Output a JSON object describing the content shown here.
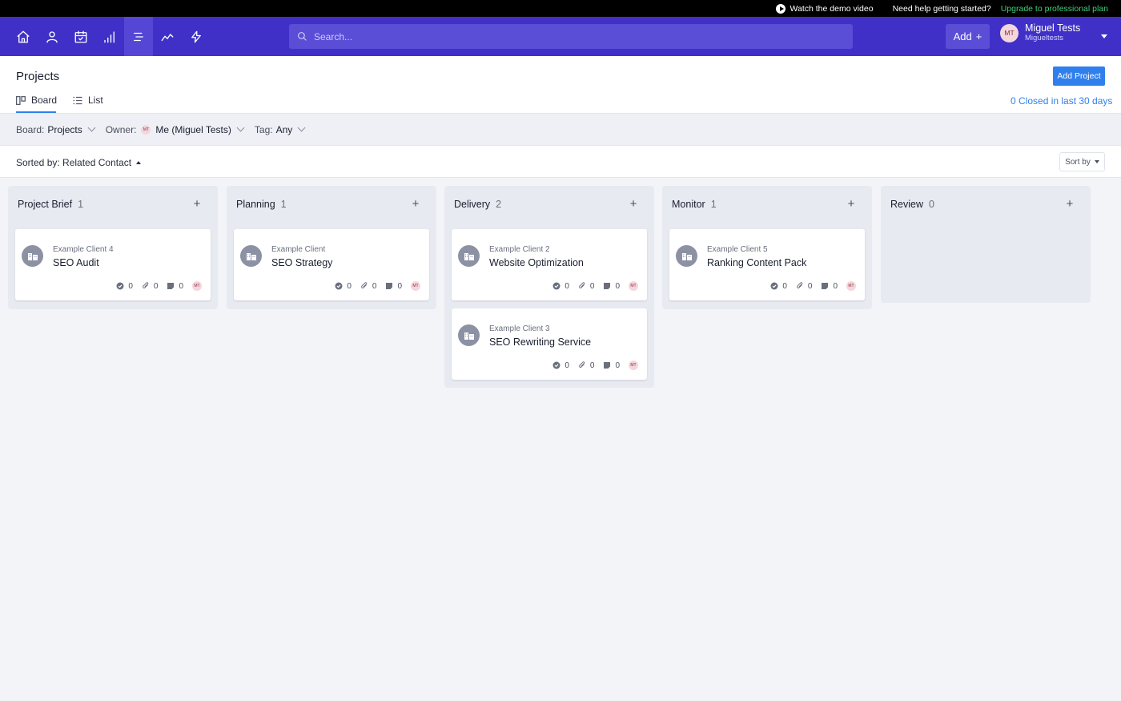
{
  "topstrip": {
    "demo": "Watch the demo video",
    "help": "Need help getting started?",
    "upgrade": "Upgrade to professional plan"
  },
  "navbar": {
    "icons": [
      "home-icon",
      "contacts-icon",
      "calendar-icon",
      "reports-icon",
      "projects-icon",
      "analytics-icon",
      "automation-icon"
    ],
    "search_placeholder": "Search...",
    "add_label": "Add",
    "user": {
      "initials": "MT",
      "name": "Miguel Tests",
      "account": "Migueltests"
    }
  },
  "page": {
    "title": "Projects",
    "add_project": "Add Project",
    "tabs": [
      {
        "label": "Board"
      },
      {
        "label": "List"
      }
    ],
    "closed_link": "0 Closed in last 30 days"
  },
  "filters": {
    "board_label": "Board:",
    "board_value": "Projects",
    "owner_label": "Owner:",
    "owner_initials": "MT",
    "owner_value": "Me (Miguel Tests)",
    "tag_label": "Tag:",
    "tag_value": "Any"
  },
  "sort": {
    "sorted_label": "Sorted by: Related Contact",
    "sort_by": "Sort by"
  },
  "columns": [
    {
      "title": "Project Brief",
      "count": "1",
      "cards": [
        {
          "client": "Example Client 4",
          "title": "SEO Audit",
          "tasks": "0",
          "files": "0",
          "notes": "0",
          "owner": "MT"
        }
      ]
    },
    {
      "title": "Planning",
      "count": "1",
      "cards": [
        {
          "client": "Example Client",
          "title": "SEO Strategy",
          "tasks": "0",
          "files": "0",
          "notes": "0",
          "owner": "MT"
        }
      ]
    },
    {
      "title": "Delivery",
      "count": "2",
      "cards": [
        {
          "client": "Example Client 2",
          "title": "Website Optimization",
          "tasks": "0",
          "files": "0",
          "notes": "0",
          "owner": "MT"
        },
        {
          "client": "Example Client 3",
          "title": "SEO Rewriting Service",
          "tasks": "0",
          "files": "0",
          "notes": "0",
          "owner": "MT"
        }
      ]
    },
    {
      "title": "Monitor",
      "count": "1",
      "cards": [
        {
          "client": "Example Client 5",
          "title": "Ranking Content Pack",
          "tasks": "0",
          "files": "0",
          "notes": "0",
          "owner": "MT"
        }
      ]
    },
    {
      "title": "Review",
      "count": "0",
      "cards": []
    }
  ],
  "colors": {
    "nav": "#4030c8",
    "accent": "#2f80ed",
    "upgrade": "#3ccf78"
  }
}
